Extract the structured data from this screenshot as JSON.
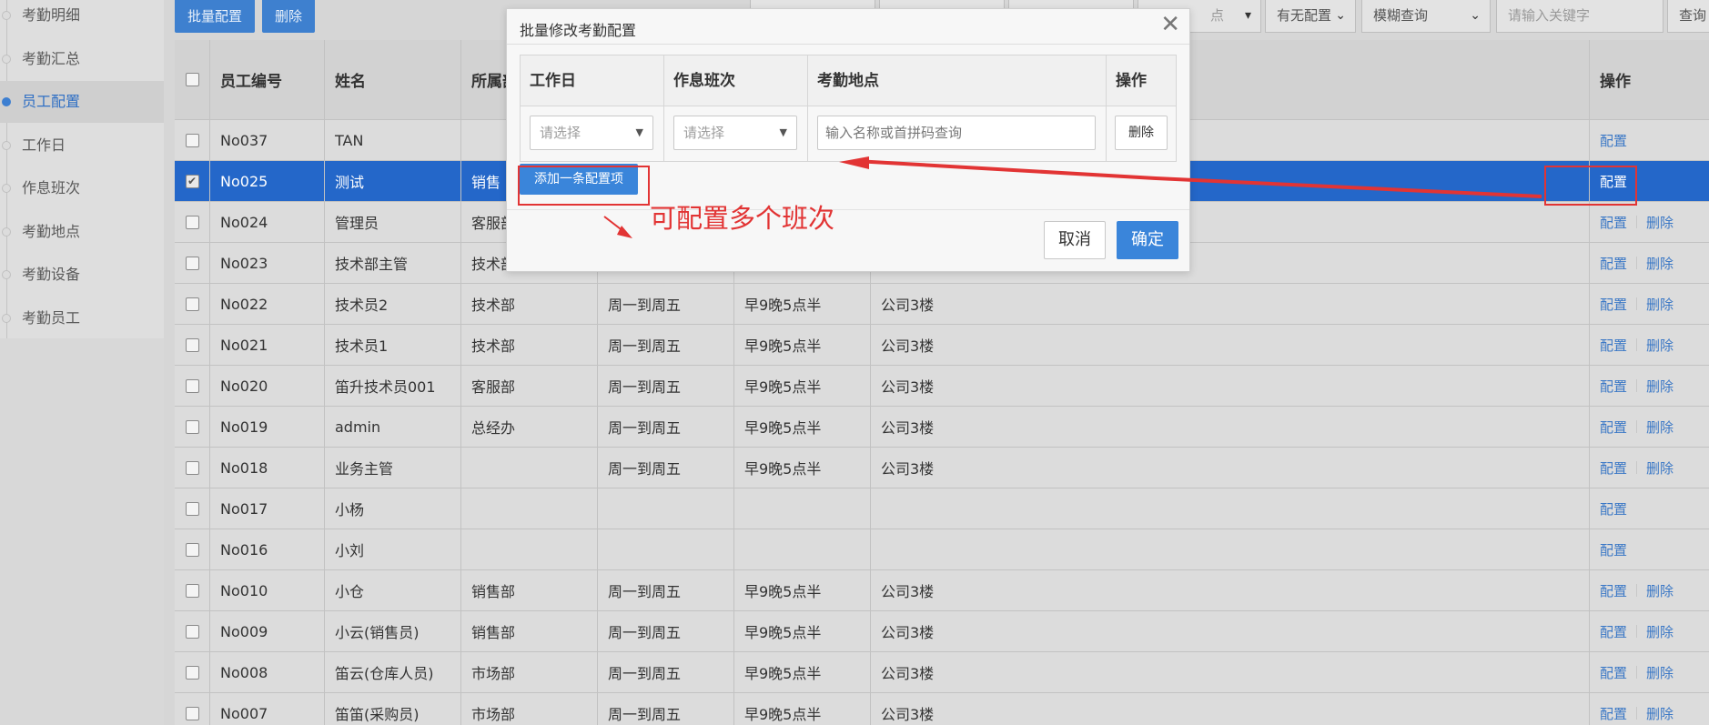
{
  "sidebar": {
    "items": [
      {
        "label": "考勤明细"
      },
      {
        "label": "考勤汇总"
      },
      {
        "label": "员工配置"
      },
      {
        "label": "工作日"
      },
      {
        "label": "作息班次"
      },
      {
        "label": "考勤地点"
      },
      {
        "label": "考勤设备"
      },
      {
        "label": "考勤员工"
      }
    ],
    "active_index": 2
  },
  "toolbar": {
    "batch_config_label": "批量配置",
    "delete_label": "删除",
    "location_select_partial": "点",
    "config_filter_value": "有无配置",
    "query_mode_value": "模糊查询",
    "keyword_placeholder": "请输入关键字",
    "query_label": "查询"
  },
  "table": {
    "headers": {
      "emp_no": "员工编号",
      "name": "姓名",
      "dept": "所属部",
      "ops": "操作"
    },
    "op_config": "配置",
    "op_delete": "删除",
    "rows": [
      {
        "emp_no": "No037",
        "name": "TAN",
        "dept": "",
        "workday": "",
        "shift": "",
        "location": "",
        "has_delete": false,
        "selected": false
      },
      {
        "emp_no": "No025",
        "name": "测试",
        "dept": "销售",
        "workday": "",
        "shift": "",
        "location": "",
        "has_delete": false,
        "selected": true
      },
      {
        "emp_no": "No024",
        "name": "管理员",
        "dept": "客服部",
        "workday": "",
        "shift": "",
        "location": "",
        "has_delete": true,
        "selected": false
      },
      {
        "emp_no": "No023",
        "name": "技术部主管",
        "dept": "技术部",
        "workday": "",
        "shift": "",
        "location": "",
        "has_delete": true,
        "selected": false
      },
      {
        "emp_no": "No022",
        "name": "技术员2",
        "dept": "技术部",
        "workday": "周一到周五",
        "shift": "早9晚5点半",
        "location": "公司3楼",
        "has_delete": true,
        "selected": false
      },
      {
        "emp_no": "No021",
        "name": "技术员1",
        "dept": "技术部",
        "workday": "周一到周五",
        "shift": "早9晚5点半",
        "location": "公司3楼",
        "has_delete": true,
        "selected": false
      },
      {
        "emp_no": "No020",
        "name": "笛升技术员001",
        "dept": "客服部",
        "workday": "周一到周五",
        "shift": "早9晚5点半",
        "location": "公司3楼",
        "has_delete": true,
        "selected": false
      },
      {
        "emp_no": "No019",
        "name": "admin",
        "dept": "总经办",
        "workday": "周一到周五",
        "shift": "早9晚5点半",
        "location": "公司3楼",
        "has_delete": true,
        "selected": false
      },
      {
        "emp_no": "No018",
        "name": "业务主管",
        "dept": "",
        "workday": "周一到周五",
        "shift": "早9晚5点半",
        "location": "公司3楼",
        "has_delete": true,
        "selected": false
      },
      {
        "emp_no": "No017",
        "name": "小杨",
        "dept": "",
        "workday": "",
        "shift": "",
        "location": "",
        "has_delete": false,
        "selected": false
      },
      {
        "emp_no": "No016",
        "name": "小刘",
        "dept": "",
        "workday": "",
        "shift": "",
        "location": "",
        "has_delete": false,
        "selected": false
      },
      {
        "emp_no": "No010",
        "name": "小仓",
        "dept": "销售部",
        "workday": "周一到周五",
        "shift": "早9晚5点半",
        "location": "公司3楼",
        "has_delete": true,
        "selected": false
      },
      {
        "emp_no": "No009",
        "name": "小云(销售员)",
        "dept": "销售部",
        "workday": "周一到周五",
        "shift": "早9晚5点半",
        "location": "公司3楼",
        "has_delete": true,
        "selected": false
      },
      {
        "emp_no": "No008",
        "name": "笛云(仓库人员)",
        "dept": "市场部",
        "workday": "周一到周五",
        "shift": "早9晚5点半",
        "location": "公司3楼",
        "has_delete": true,
        "selected": false
      },
      {
        "emp_no": "No007",
        "name": "笛笛(采购员)",
        "dept": "市场部",
        "workday": "周一到周五",
        "shift": "早9晚5点半",
        "location": "公司3楼",
        "has_delete": true,
        "selected": false
      }
    ]
  },
  "dialog": {
    "title": "批量修改考勤配置",
    "headers": {
      "workday": "工作日",
      "shift": "作息班次",
      "location": "考勤地点",
      "ops": "操作"
    },
    "workday_placeholder": "请选择",
    "shift_placeholder": "请选择",
    "location_placeholder": "输入名称或首拼码查询",
    "row_delete_label": "删除",
    "add_item_label": "添加一条配置项",
    "cancel_label": "取消",
    "ok_label": "确定"
  },
  "annotation": {
    "text": "可配置多个班次",
    "color": "#e23434"
  },
  "colors": {
    "accent": "#3a85da",
    "selected_row": "#2467c9",
    "link": "#3b78c6"
  }
}
